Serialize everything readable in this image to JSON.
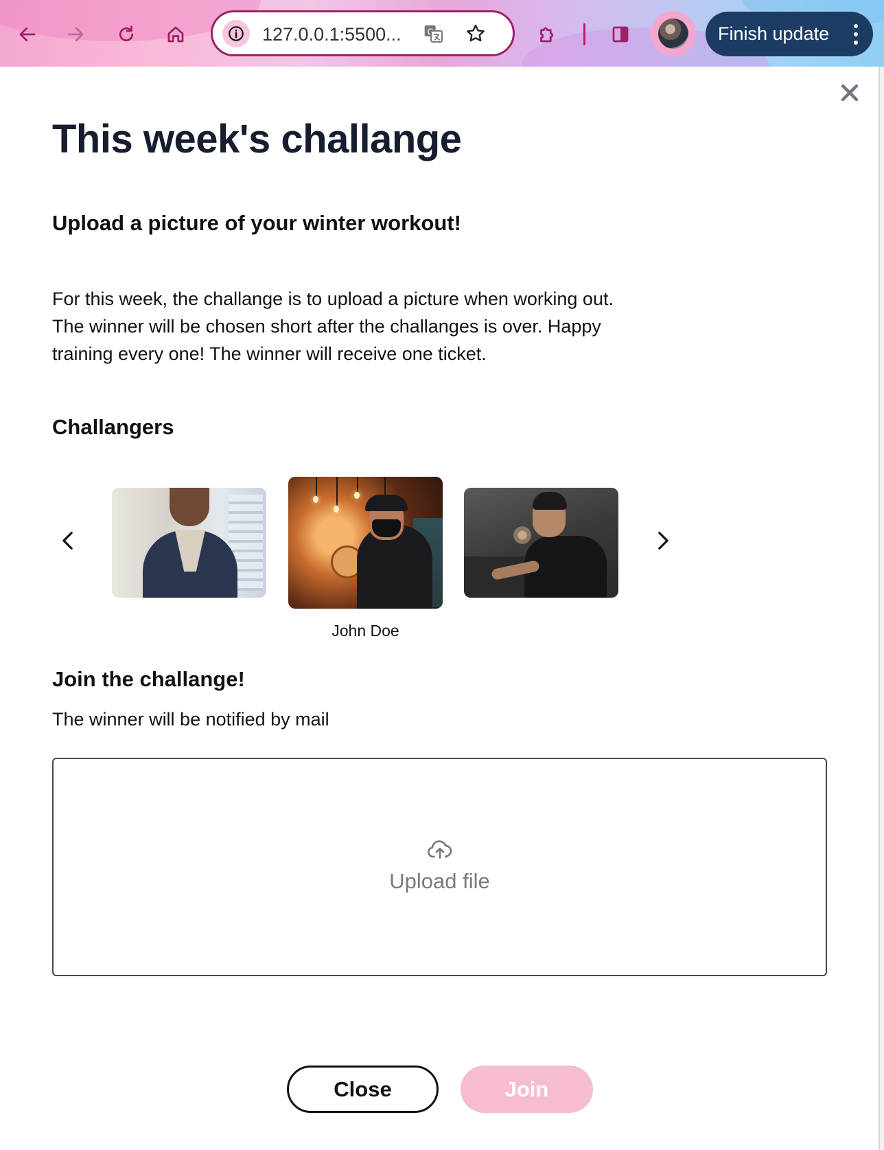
{
  "browser": {
    "url": "127.0.0.1:5500...",
    "finish_update_label": "Finish update",
    "icons": [
      "back-arrow-icon",
      "forward-arrow-icon",
      "reload-icon",
      "home-icon",
      "site-info-icon",
      "translate-icon",
      "star-icon",
      "extensions-icon",
      "side-panel-icon",
      "profile-avatar",
      "more-vertical-icon"
    ],
    "accent": "#a01f67",
    "finish_button_color": "#1d3c63"
  },
  "dialog": {
    "title": "This week's challange",
    "subtitle": "Upload a picture of your winter workout!",
    "description": "For this week, the challange is to upload a picture when working out. The winner will be chosen short after the challanges is over. Happy training every one! The winner will receive one ticket.",
    "challengers_heading": "Challangers",
    "carousel": {
      "selected_name": "John Doe",
      "selected_index": 1
    },
    "join_heading": "Join the challange!",
    "join_note": "The winner will be notified by mail",
    "upload_label": "Upload file",
    "close_label": "Close",
    "join_label": "Join",
    "join_button_color": "#f5bcd2"
  }
}
